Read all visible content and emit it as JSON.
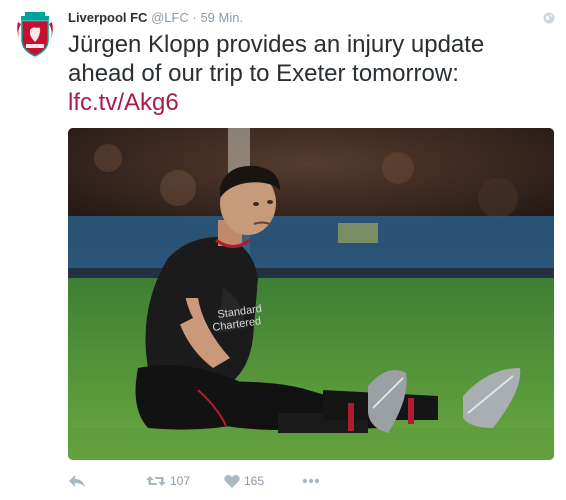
{
  "tweet": {
    "author_name": "Liverpool FC",
    "handle": "@LFC",
    "separator": "·",
    "timestamp": "59 Min.",
    "text_line1": "Jürgen Klopp provides an injury update",
    "text_line2": "ahead of our trip to Exeter tomorrow:",
    "link": "lfc.tv/Akg6",
    "avatar_icon": "liverbird-crest-icon",
    "visibility_icon": "globe-icon",
    "media_description_icon": "player-photo"
  },
  "actions": {
    "reply_icon": "reply-icon",
    "retweet_icon": "retweet-icon",
    "retweet_count": "107",
    "like_icon": "heart-icon",
    "like_count": "165",
    "more_icon": "more-dots-icon"
  },
  "colors": {
    "link": "#ab1a45",
    "meta": "#8899a6",
    "text": "#292f33",
    "crest_red": "#c8102e",
    "crest_green": "#00a398"
  }
}
